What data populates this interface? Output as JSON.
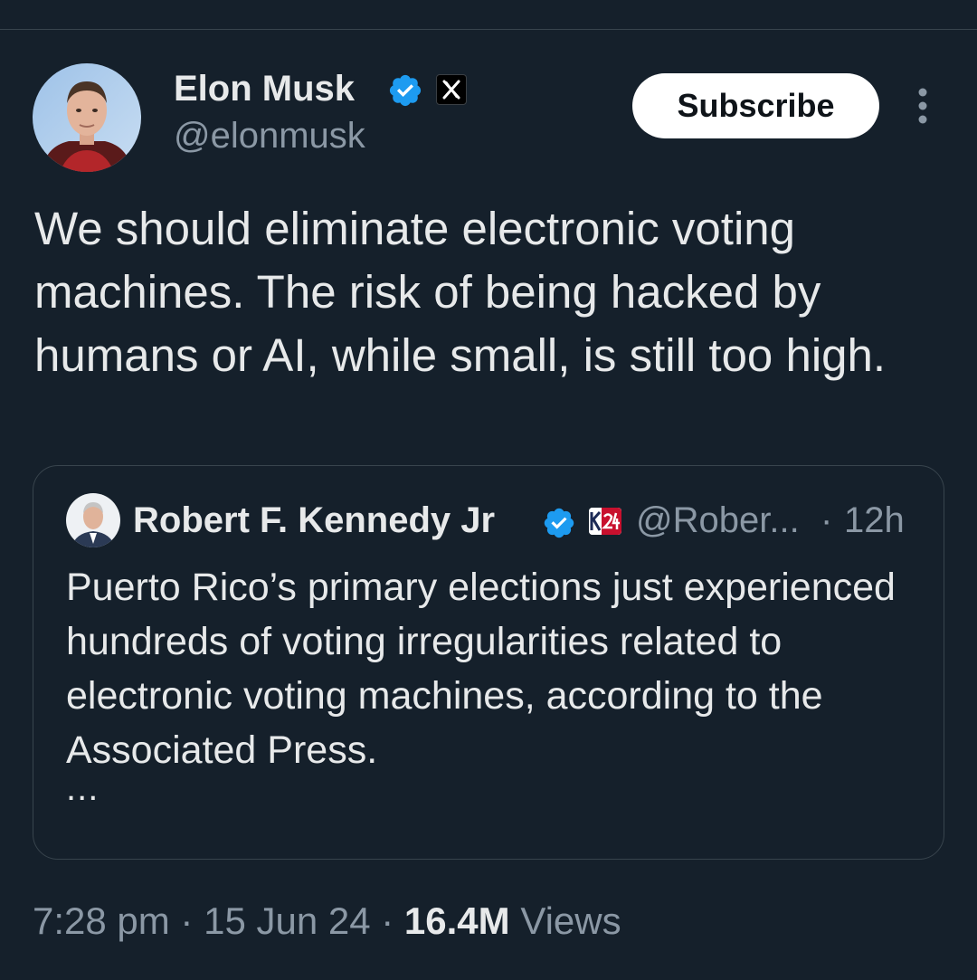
{
  "tweet": {
    "author": {
      "name": "Elon Musk",
      "handle": "@elonmusk",
      "verified": true,
      "affiliate_icon": "x-logo-icon"
    },
    "subscribe_label": "Subscribe",
    "more_icon": "more-vertical-icon",
    "text": "We should eliminate electronic voting machines. The risk of being hacked by humans or AI, while small, is still too high.",
    "quoted": {
      "name": "Robert F. Kennedy Jr",
      "handle": "@Rober...",
      "separator": "·",
      "time": "12h",
      "verified": true,
      "affiliate_icon": "kennedy24-icon",
      "text": "Puerto Rico’s primary elections just experienced hundreds of voting irregularities related to electronic voting machines, according to the Associated Press.",
      "ellipsis": "..."
    },
    "meta": {
      "time": "7:28 pm",
      "separator": " · ",
      "date": "15 Jun 24",
      "views_count": "16.4M",
      "views_label": "Views"
    }
  },
  "colors": {
    "background": "#15202b",
    "text": "#e7e9ea",
    "secondary": "#8b98a5",
    "border": "#38444d",
    "verified": "#1d9bf0"
  }
}
